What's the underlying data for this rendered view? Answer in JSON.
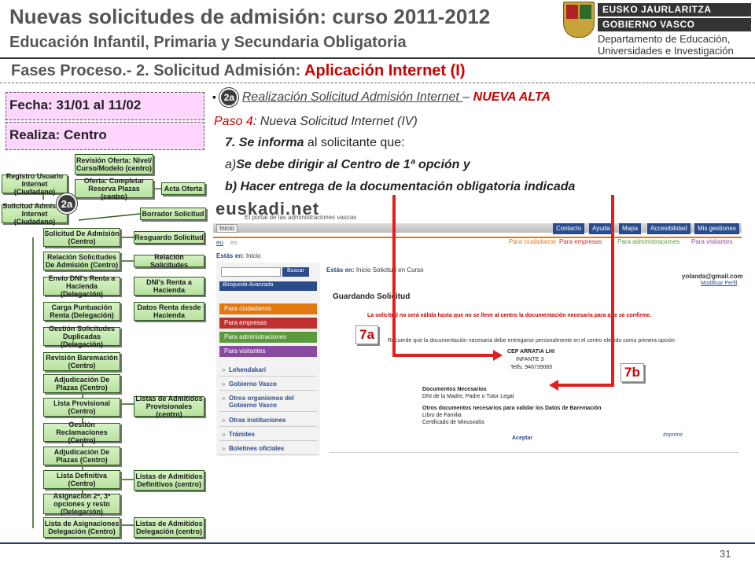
{
  "header": {
    "title": "Nuevas solicitudes de admisión: curso 2011-2012",
    "subtitle": "Educación Infantil, Primaria y Secundaria Obligatoria",
    "logo": {
      "line1": "EUSKO JAURLARITZA",
      "line2": "GOBIERNO VASCO",
      "dept1": "Departamento de Educación,",
      "dept2": "Universidades e Investigación"
    }
  },
  "phase": {
    "prefix": "Fases Proceso.- 2. Solicitud Admisión: ",
    "highlight": "Aplicación Internet (I)"
  },
  "info": {
    "fecha": "Fecha: 31/01 al 11/02",
    "realiza": "Realiza: Centro"
  },
  "flow": {
    "badge": "2a",
    "boxes": [
      "Revisión Oferta: Nivel/ Curso/Modelo (centro)",
      "Registro Usuario Internet (Ciudadano)",
      "Oferta: Completar Reserva Plazas (centro)",
      "Acta Oferta",
      "Solicitud Admisión Internet (Ciudadano)",
      "Borrador Solicitud",
      "Solicitud De Admisión (Centro)",
      "Resguardo Solicitud",
      "Relación Solicitudes De Admisión (Centro)",
      "Relación Solicitudes",
      "Envío DNI's Renta a Hacienda (Delegación)",
      "DNI's Renta a Hacienda",
      "Carga Puntuación Renta (Delegación)",
      "Datos Renta desde Hacienda",
      "Gestión Solicitudes Duplicadas (Delegación)",
      "Revisión Baremación (Centro)",
      "Adjudicación De Plazas (Centro)",
      "Lista Provisional (Centro)",
      "Listas de Admitidos Provisionales (centro)",
      "Gestión Reclamaciones (Centro)",
      "Adjudicación De Plazas (Centro)",
      "Lista Definitiva (Centro)",
      "Listas de Admitidos Definitivos (centro)",
      "Asignación 2ª, 3ª opciones y resto (Delegación)",
      "Lista de Asignaciones Delegación (Centro)",
      "Listas de Admitidos Delegación (centro)"
    ]
  },
  "content": {
    "bullet_badge": "2a",
    "bullet_text": " Realización Solicitud Admisión Internet ",
    "bullet_dash": "– ",
    "bullet_red": "NUEVA ALTA",
    "paso_label": "Paso 4",
    "paso_rest": ": Nueva Solicitud Internet (IV)",
    "line7_bold": "7. Se informa",
    "line7_rest": " al solicitante que:",
    "line_a_prefix": "a)",
    "line_a_bold": "Se debe dirigir al Centro de 1ª opción y",
    "line_b": "b) Hacer entrega de la  documentación obligatoria indicada"
  },
  "site": {
    "brand": "euskadi.net",
    "tagline": "El portal de las administraciones vascas",
    "inicio_tab": "Inicio",
    "lang_eu": "eu",
    "lang_es": "es",
    "nav": [
      "Contacto",
      "Ayuda",
      "Mapa",
      "Accesibilidad",
      "Mis gestiones"
    ],
    "audiences": [
      "Para ciudadanos",
      "Para empresas",
      "Para administraciones",
      "Para visitantes"
    ],
    "breadcrumb_label": "Estás en:",
    "breadcrumb_value": "Inicio",
    "breadcrumb2_value": "Inicio   Solicitud en Curso",
    "search_button": "Buscar",
    "advanced_search": "Búsqueda Avanzada",
    "side_colored": [
      "Para ciudadanos",
      "Para empresas",
      "Para administraciones",
      "Para visitantes"
    ],
    "side_links": [
      "Lehendakari",
      "Gobierno Vasco",
      "Otros organismos del Gobierno Vasco",
      "Otras instituciones",
      "Trámites",
      "Boletines oficiales"
    ],
    "user_email": "yolanda@gmail.com",
    "modify_profile": "Modificar Perfil",
    "heading": "Guardando Solicitud",
    "warning": "La solicitud no será válida hasta que no se lleve al centro la documentación necesaria para que se confirme.",
    "reminder": "Recuerde que la documentación necesaria debe entregarse personalmente en el centro elegido como primera opción:",
    "center_name": "CEP ARRATIA LHI",
    "center_address": "INFANTE 3",
    "center_phone": "Telfs. 946739065",
    "docs_title": "Documentos Necesarios",
    "docs_item": "DNI de la Madre, Padre o Tutor Legal",
    "other_docs_title": "Otros documentos necesarios para validar los Datos de Baremación",
    "other_docs_1": "Libro de Familia",
    "other_docs_2": "Certificado de Minusvalía",
    "accept": "Aceptar",
    "print": "Imprimir"
  },
  "annotations": {
    "label_7a": "7a",
    "label_7b": "7b"
  },
  "footer": {
    "page_number": "31"
  },
  "colors": {
    "accent_red": "#cc0000",
    "info_box": "#ffd6ff",
    "flow_box": "#c6eab0",
    "nav_blue": "#2b4b8c",
    "orange": "#e07a10",
    "purple": "#8a4aa0",
    "green": "#5a9a3a",
    "red": "#c0302e"
  }
}
